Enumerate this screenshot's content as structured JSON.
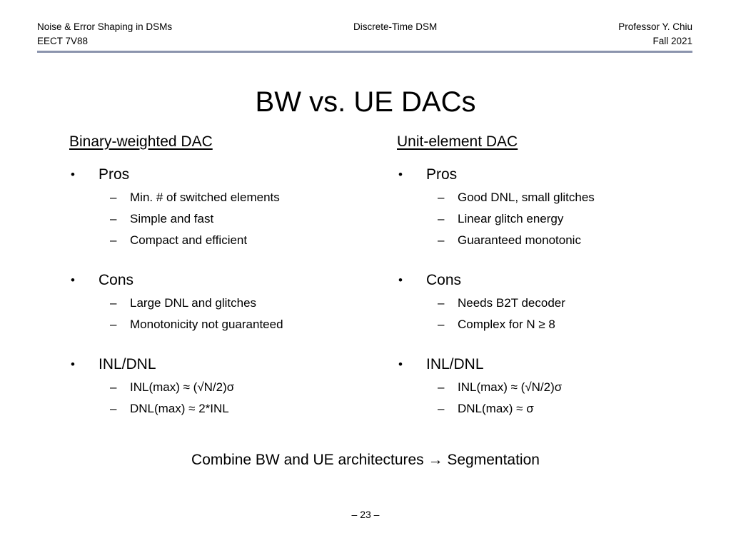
{
  "header": {
    "left_line1": "Noise & Error Shaping in DSMs",
    "left_line2": "EECT 7V88",
    "center_line1": "Discrete-Time DSM",
    "center_line2": "",
    "right_line1": "Professor Y. Chiu",
    "right_line2": "Fall 2021",
    "rule_color": "#8b94ad"
  },
  "title": "BW vs. UE DACs",
  "columns": [
    {
      "heading": "Binary-weighted DAC",
      "groups": [
        {
          "label": "Pros",
          "bullet": "•",
          "items": [
            {
              "dash": "–",
              "text": "Min. # of switched elements"
            },
            {
              "dash": "–",
              "text": "Simple and fast"
            },
            {
              "dash": "–",
              "text": "Compact and efficient"
            }
          ]
        },
        {
          "label": "Cons",
          "bullet": "•",
          "items": [
            {
              "dash": "–",
              "text": "Large DNL and glitches"
            },
            {
              "dash": "–",
              "text": "Monotonicity not guaranteed"
            }
          ]
        },
        {
          "label": "INL/DNL",
          "bullet": "•",
          "items": [
            {
              "dash": "–",
              "text": "INL(max) ≈ (√N/2)σ"
            },
            {
              "dash": "–",
              "text": "DNL(max) ≈ 2*INL"
            }
          ]
        }
      ]
    },
    {
      "heading": "Unit-element DAC",
      "groups": [
        {
          "label": "Pros",
          "bullet": "•",
          "items": [
            {
              "dash": "–",
              "text": "Good DNL, small glitches"
            },
            {
              "dash": "–",
              "text": "Linear glitch energy"
            },
            {
              "dash": "–",
              "text": "Guaranteed monotonic"
            }
          ]
        },
        {
          "label": "Cons",
          "bullet": "•",
          "items": [
            {
              "dash": "–",
              "text": "Needs B2T decoder"
            },
            {
              "dash": "–",
              "text": "Complex for N ≥ 8"
            }
          ]
        },
        {
          "label": "INL/DNL",
          "bullet": "•",
          "items": [
            {
              "dash": "–",
              "text": "INL(max) ≈ (√N/2)σ"
            },
            {
              "dash": "–",
              "text": "DNL(max) ≈ σ"
            }
          ]
        }
      ]
    }
  ],
  "conclusion": "Combine BW and UE architectures → Segmentation",
  "page_number": "– 23 –"
}
